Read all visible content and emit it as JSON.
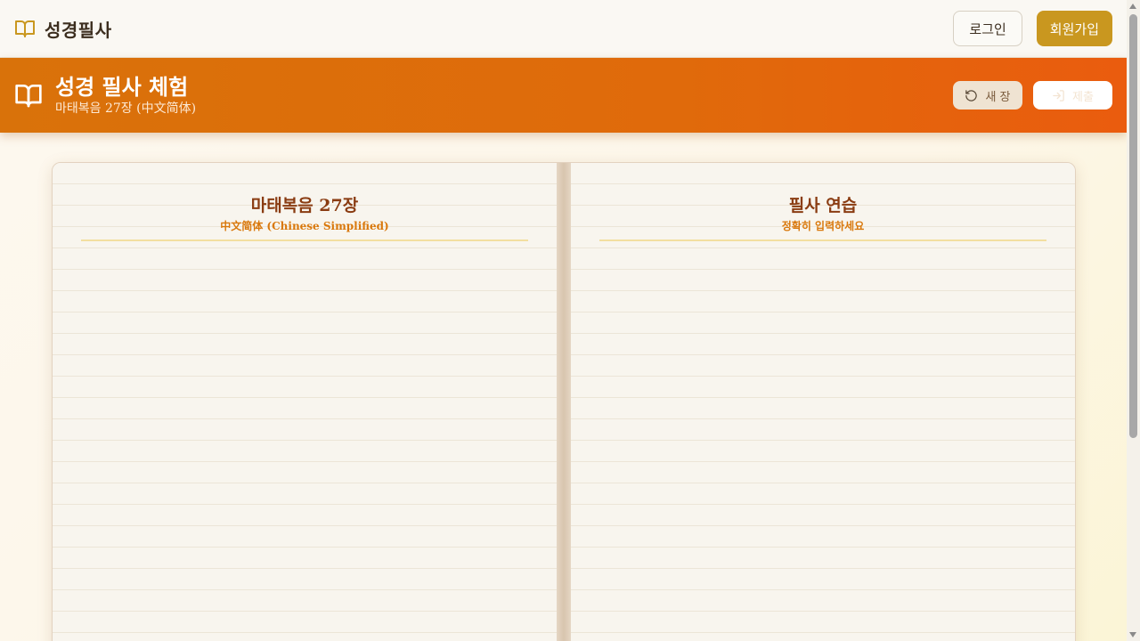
{
  "nav": {
    "brand": "성경필사",
    "login_label": "로그인",
    "signup_label": "회원가입"
  },
  "header": {
    "title": "성경 필사 체험",
    "subtitle": "마태복음 27장 (中文简体)",
    "reset_label": "새 장",
    "submit_label": "제출"
  },
  "book": {
    "left_page": {
      "title": "마태복음 27장",
      "subtitle": "中文简体 (Chinese Simplified)"
    },
    "right_page": {
      "title": "필사 연습",
      "subtitle": "정확히 입력하세요"
    }
  },
  "colors": {
    "accent_gold": "#c9971f",
    "header_orange": "#e06a0b",
    "title_brown": "#8a3c12",
    "subtitle_orange": "#d9780c"
  },
  "icons": {
    "brand": "book-open-icon",
    "reset": "rotate-ccw-icon",
    "submit": "log-in-icon"
  }
}
